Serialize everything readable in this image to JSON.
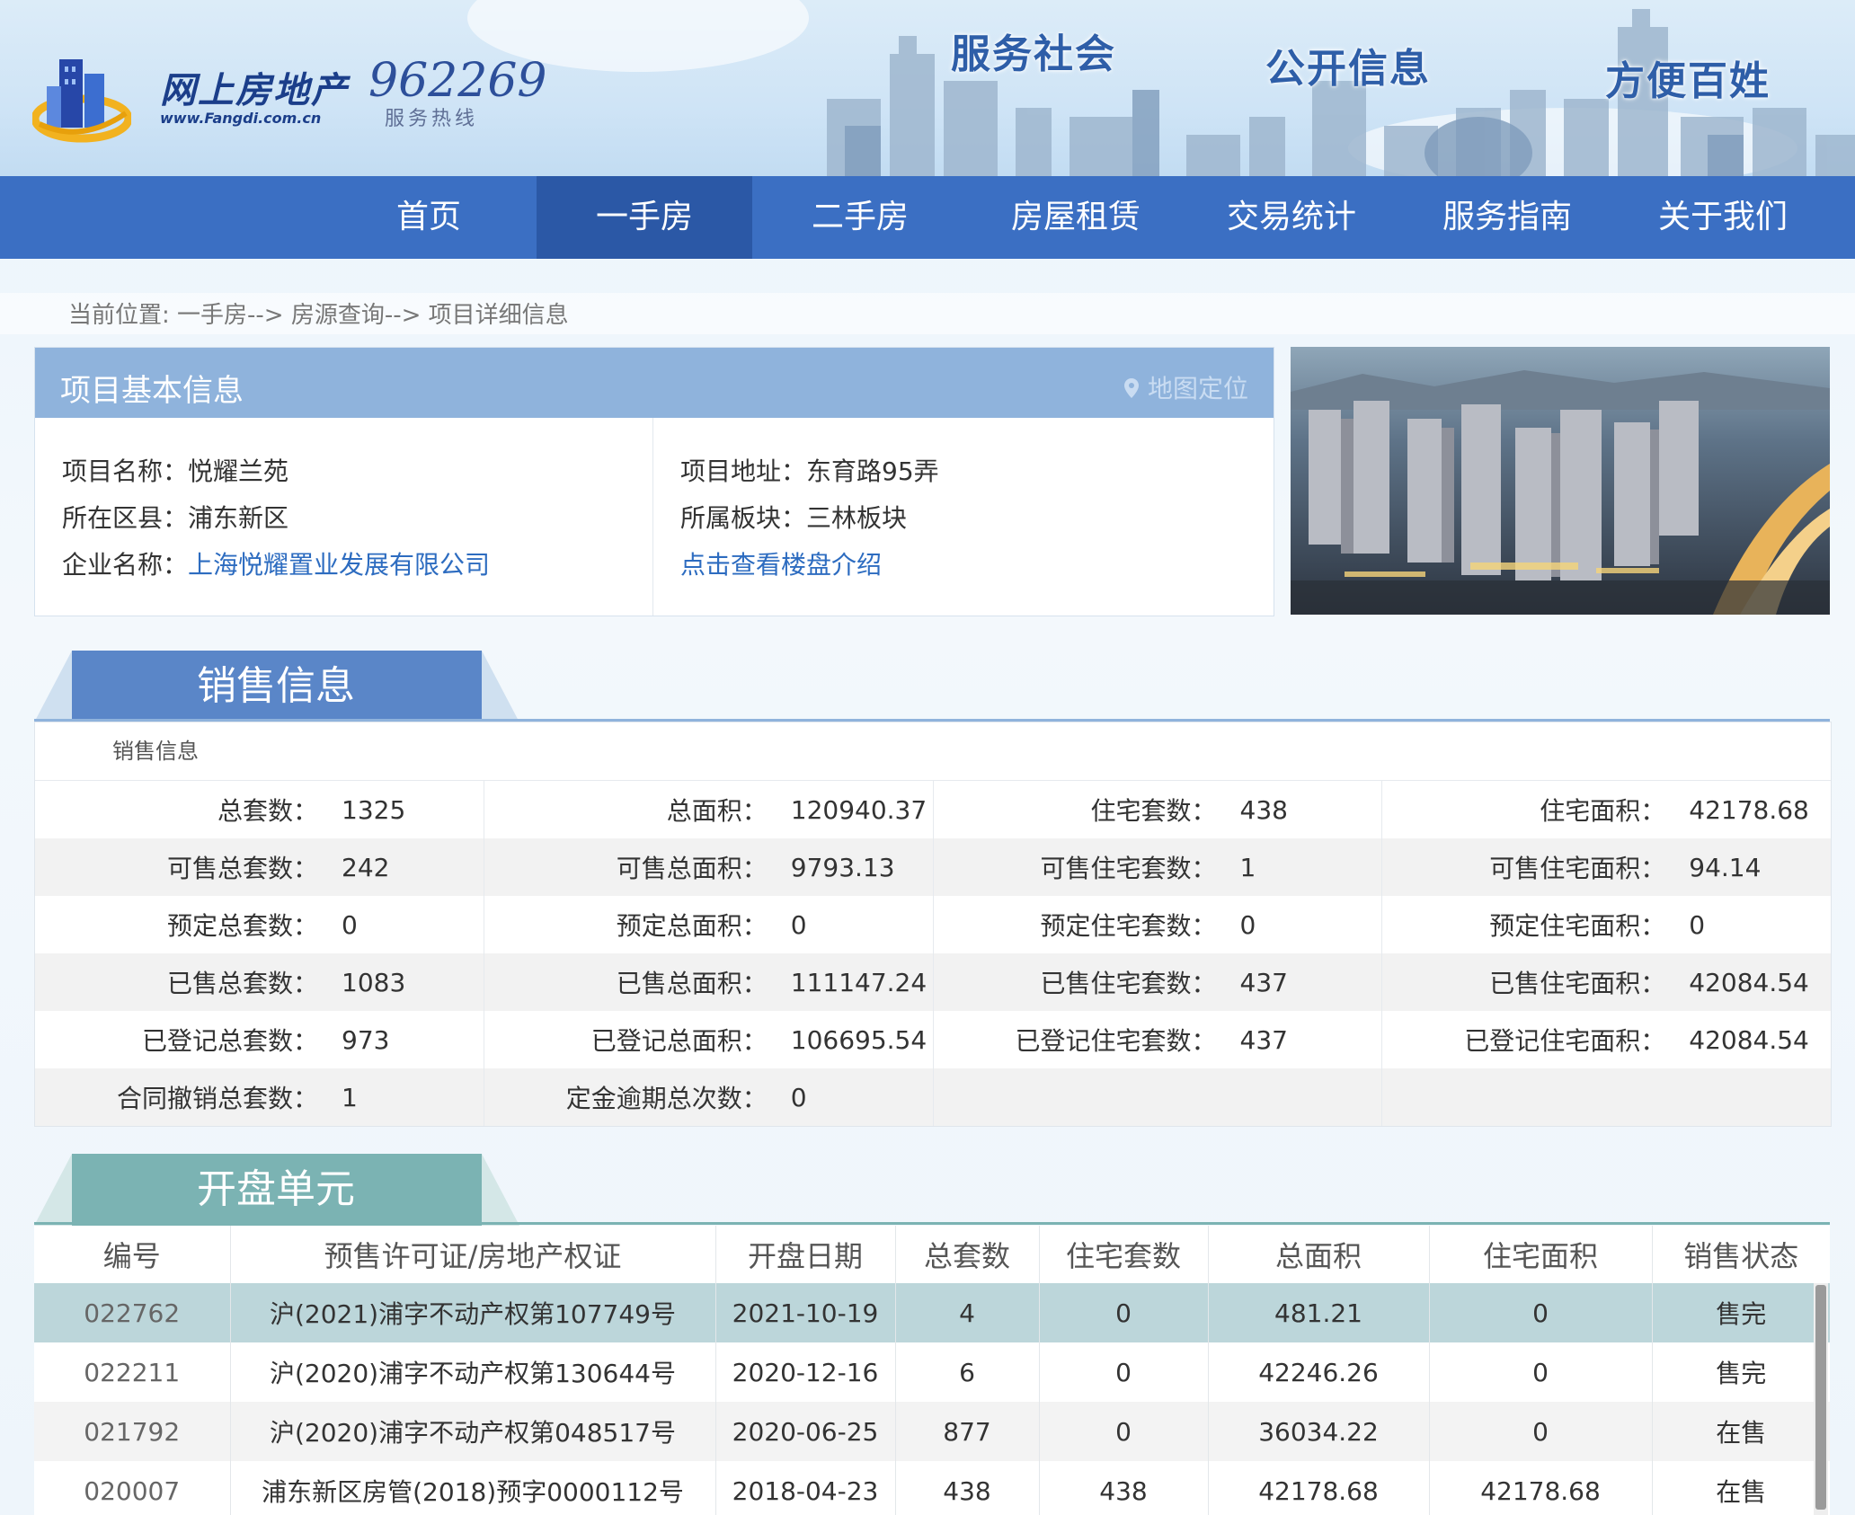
{
  "header": {
    "logo_text": "网上房地产",
    "logo_url": "www.Fangdi.com.cn",
    "hotline_number": "962269",
    "hotline_label": "服务热线",
    "slogans": [
      "服务社会",
      "公开信息",
      "方便百姓"
    ]
  },
  "nav": {
    "items": [
      {
        "label": "首页",
        "active": false
      },
      {
        "label": "一手房",
        "active": true
      },
      {
        "label": "二手房",
        "active": false
      },
      {
        "label": "房屋租赁",
        "active": false
      },
      {
        "label": "交易统计",
        "active": false
      },
      {
        "label": "服务指南",
        "active": false
      },
      {
        "label": "关于我们",
        "active": false
      }
    ]
  },
  "breadcrumb": "当前位置:  一手房--> 房源查询--> 项目详细信息",
  "project": {
    "title": "项目基本信息",
    "map_link": "地图定位",
    "name_label": "项目名称：",
    "name_value": "悦耀兰苑",
    "district_label": "所在区县：",
    "district_value": "浦东新区",
    "company_label": "企业名称：",
    "company_value": "上海悦耀置业发展有限公司",
    "address_label": "项目地址：",
    "address_value": "东育路95弄",
    "block_label": "所属板块：",
    "block_value": "三林板块",
    "intro_link": "点击查看楼盘介绍"
  },
  "sales": {
    "tab": "销售信息",
    "caption": "销售信息",
    "rows": [
      [
        [
          "总套数：",
          "1325"
        ],
        [
          "总面积：",
          "120940.37"
        ],
        [
          "住宅套数：",
          "438"
        ],
        [
          "住宅面积：",
          "42178.68"
        ]
      ],
      [
        [
          "可售总套数：",
          "242"
        ],
        [
          "可售总面积：",
          "9793.13"
        ],
        [
          "可售住宅套数：",
          "1"
        ],
        [
          "可售住宅面积：",
          "94.14"
        ]
      ],
      [
        [
          "预定总套数：",
          "0"
        ],
        [
          "预定总面积：",
          "0"
        ],
        [
          "预定住宅套数：",
          "0"
        ],
        [
          "预定住宅面积：",
          "0"
        ]
      ],
      [
        [
          "已售总套数：",
          "1083"
        ],
        [
          "已售总面积：",
          "111147.24"
        ],
        [
          "已售住宅套数：",
          "437"
        ],
        [
          "已售住宅面积：",
          "42084.54"
        ]
      ],
      [
        [
          "已登记总套数：",
          "973"
        ],
        [
          "已登记总面积：",
          "106695.54"
        ],
        [
          "已登记住宅套数：",
          "437"
        ],
        [
          "已登记住宅面积：",
          "42084.54"
        ]
      ],
      [
        [
          "合同撤销总套数：",
          "1"
        ],
        [
          "定金逾期总次数：",
          "0"
        ],
        [
          "",
          ""
        ],
        [
          "",
          ""
        ]
      ]
    ]
  },
  "units": {
    "tab": "开盘单元",
    "headers": [
      "编号",
      "预售许可证/房地产权证",
      "开盘日期",
      "总套数",
      "住宅套数",
      "总面积",
      "住宅面积",
      "销售状态"
    ],
    "rows": [
      [
        "022762",
        "沪(2021)浦字不动产权第107749号",
        "2021-10-19",
        "4",
        "0",
        "481.21",
        "0",
        "售完"
      ],
      [
        "022211",
        "沪(2020)浦字不动产权第130644号",
        "2020-12-16",
        "6",
        "0",
        "42246.26",
        "0",
        "售完"
      ],
      [
        "021792",
        "沪(2020)浦字不动产权第048517号",
        "2020-06-25",
        "877",
        "0",
        "36034.22",
        "0",
        "在售"
      ],
      [
        "020007",
        "浦东新区房管(2018)预字0000112号",
        "2018-04-23",
        "438",
        "438",
        "42178.68",
        "42178.68",
        "在售"
      ]
    ]
  },
  "colors": {
    "nav_bg": "#3b6fc3",
    "nav_active": "#2b58a6",
    "sales_tab": "#5a86c8",
    "units_tab": "#7bb3b3",
    "status_sold_out": "#d42a2a",
    "status_on_sale": "#2e8b2e"
  }
}
